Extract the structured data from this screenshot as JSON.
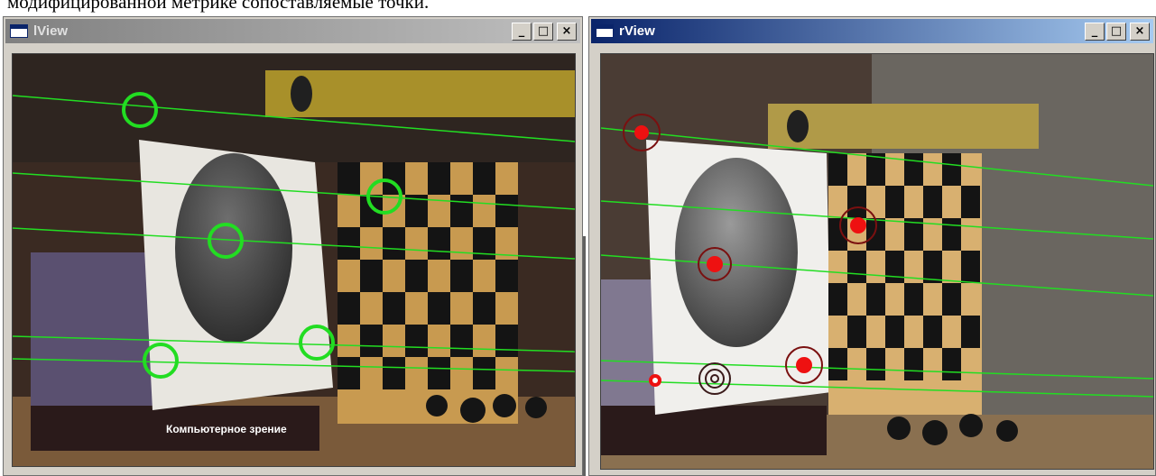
{
  "caption": "модифицированной метрике сопоставляемые точки.",
  "windows": {
    "left": {
      "title": "lView"
    },
    "right": {
      "title": "rView"
    }
  },
  "controls": {
    "minimize": "_",
    "maximize": "□",
    "close": "×"
  },
  "icons": {
    "app": "window-app-icon",
    "minimize": "minimize-icon",
    "maximize": "maximize-icon",
    "close": "close-icon"
  },
  "scene": {
    "left_marker_color": "#22dd22",
    "right_marker_color": "#ee1111",
    "epipolar_line_color": "#22dd22",
    "book_cover_text": "Компьютерное зрение"
  }
}
